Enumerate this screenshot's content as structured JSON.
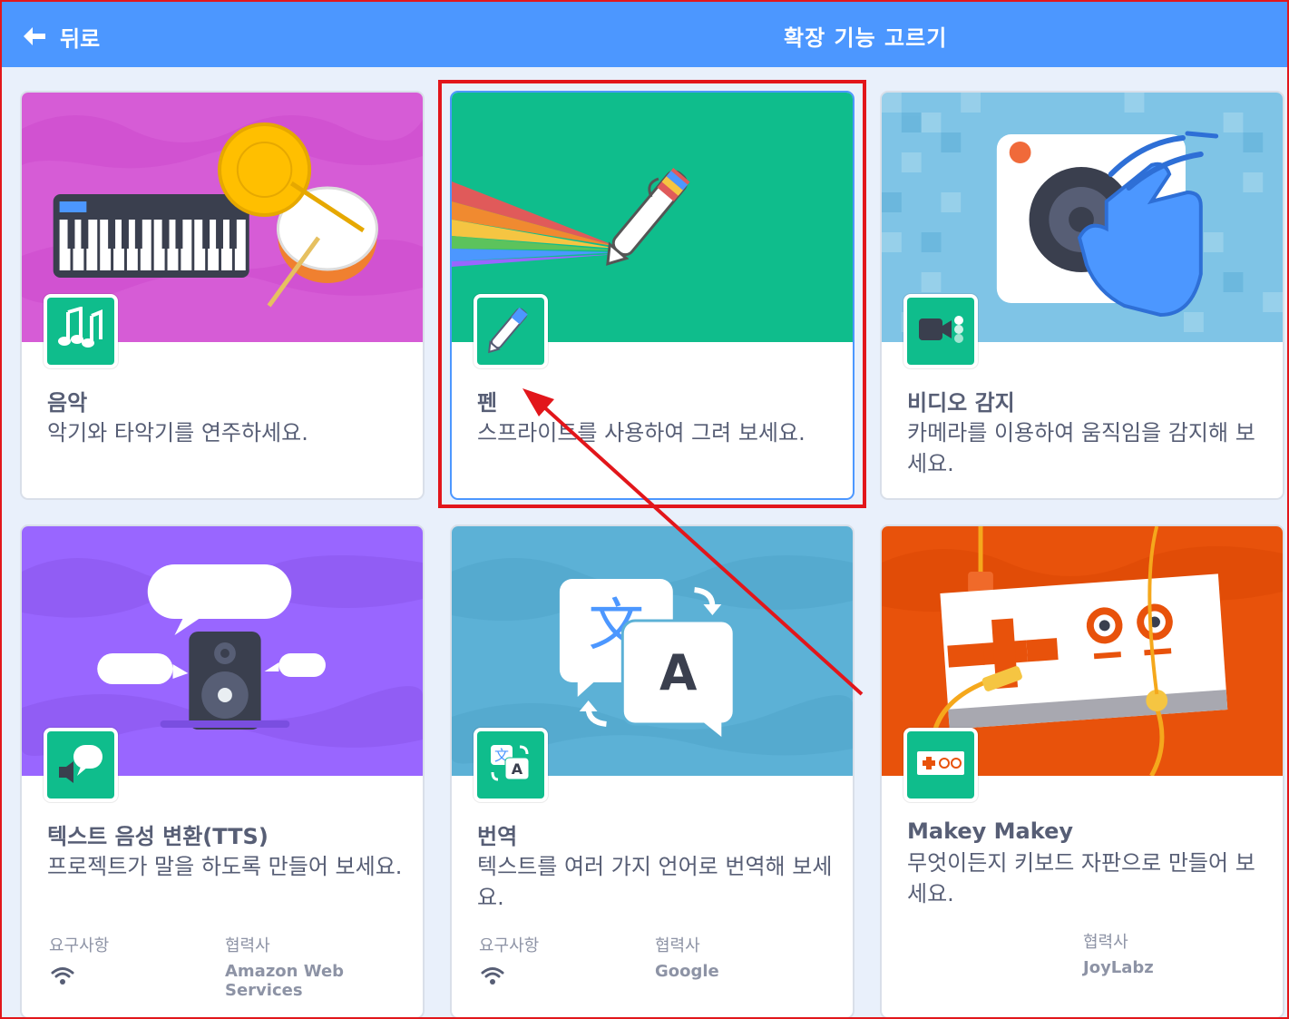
{
  "header": {
    "back_label": "뒤로",
    "title": "확장 기능 고르기",
    "color": "#4c97ff"
  },
  "extensions": [
    {
      "title": "음악",
      "description": "악기와 타악기를 연주하세요.",
      "icon": "music-notes-icon",
      "banner_color": "#d65cd6"
    },
    {
      "title": "펜",
      "description": "스프라이트를 사용하여 그려 보세요.",
      "icon": "pen-icon",
      "banner_color": "#0fbd8c",
      "selected": true
    },
    {
      "title": "비디오 감지",
      "description": "카메라를 이용하여 움직임을 감지해 보세요.",
      "icon": "video-camera-icon",
      "banner_color": "#7fc4e6"
    },
    {
      "title": "텍스트 음성 변환(TTS)",
      "description": "프로젝트가 말을 하도록 만들어 보세요.",
      "icon": "speech-bubble-icon",
      "banner_color": "#9966ff",
      "requirements_label": "요구사항",
      "requirement_icon": "wifi-icon",
      "partner_label": "협력사",
      "partner": "Amazon Web Services"
    },
    {
      "title": "번역",
      "description": "텍스트를 여러 가지 언어로 번역해 보세요.",
      "icon": "translate-icon",
      "banner_color": "#5cb1d6",
      "requirements_label": "요구사항",
      "requirement_icon": "wifi-icon",
      "partner_label": "협력사",
      "partner": "Google"
    },
    {
      "title": "Makey Makey",
      "description": "무엇이든지 키보드 자판으로 만들어 보세요.",
      "icon": "makey-board-icon",
      "banner_color": "#e8520b",
      "partner_label": "협력사",
      "partner": "JoyLabz"
    }
  ],
  "annotation": {
    "highlight_color": "#e2161b"
  }
}
